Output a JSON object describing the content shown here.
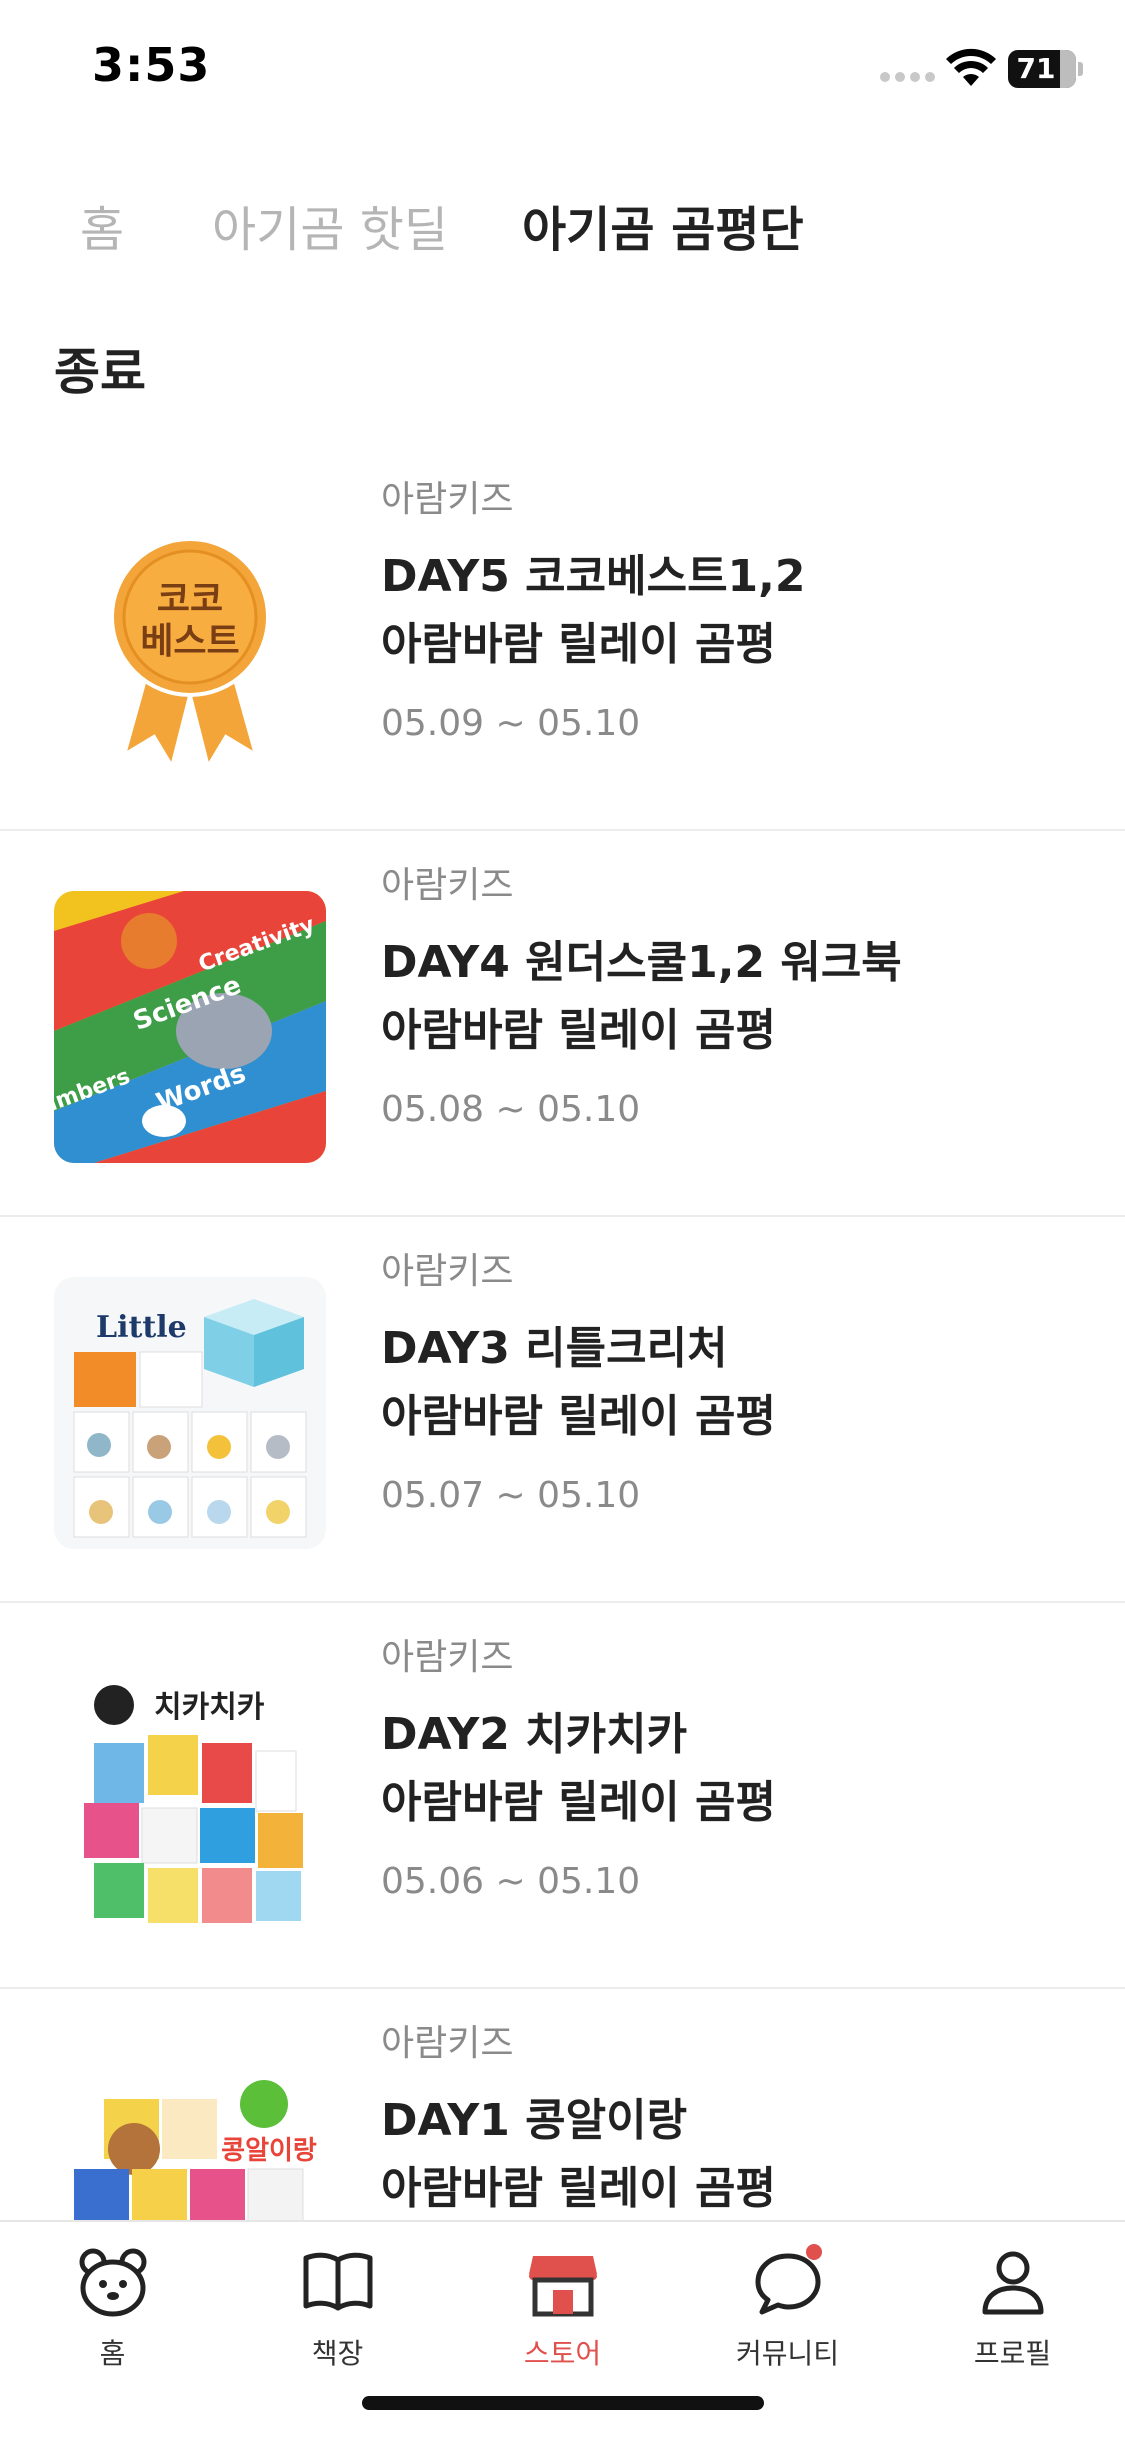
{
  "status_bar": {
    "time": "3:53",
    "battery": "71"
  },
  "tabs": [
    {
      "label": "홈",
      "active": false
    },
    {
      "label": "아기곰 핫딜",
      "active": false
    },
    {
      "label": "아기곰 곰평단",
      "active": true
    }
  ],
  "section": {
    "title": "종료"
  },
  "items": [
    {
      "brand": "아람키즈",
      "title_line1": "DAY5 코코베스트1,2",
      "title_line2": "아람바람 릴레이 곰평",
      "period": "05.09 ~ 05.10",
      "thumb_text": [
        "코코",
        "베스트"
      ]
    },
    {
      "brand": "아람키즈",
      "title_line1": "DAY4 원더스쿨1,2 워크북",
      "title_line2": "아람바람 릴레이 곰평",
      "period": "05.08 ~ 05.10",
      "thumb_words": [
        "Science",
        "Creativity",
        "Words",
        "Numbers"
      ]
    },
    {
      "brand": "아람키즈",
      "title_line1": "DAY3 리틀크리처",
      "title_line2": "아람바람 릴레이 곰평",
      "period": "05.07 ~ 05.10",
      "thumb_text": [
        "Little"
      ]
    },
    {
      "brand": "아람키즈",
      "title_line1": "DAY2 치카치카",
      "title_line2": "아람바람 릴레이 곰평",
      "period": "05.06 ~ 05.10",
      "thumb_text": [
        "치카치카"
      ]
    },
    {
      "brand": "아람키즈",
      "title_line1": "DAY1 콩알이랑",
      "title_line2": "아람바람 릴레이 곰평",
      "period": "",
      "thumb_text": [
        "콩알이랑"
      ]
    }
  ],
  "bottom_nav": [
    {
      "label": "홈",
      "icon": "bear-icon",
      "active": false
    },
    {
      "label": "책장",
      "icon": "book-icon",
      "active": false
    },
    {
      "label": "스토어",
      "icon": "store-icon",
      "active": true
    },
    {
      "label": "커뮤니티",
      "icon": "chat-bubble-icon",
      "active": false,
      "badge": true
    },
    {
      "label": "프로필",
      "icon": "person-icon",
      "active": false
    }
  ],
  "colors": {
    "accent": "#e0504d",
    "medal": "#f3a53a",
    "text": "#222222",
    "muted": "#8a8a8a",
    "tab_inactive": "#b5b5b5"
  }
}
